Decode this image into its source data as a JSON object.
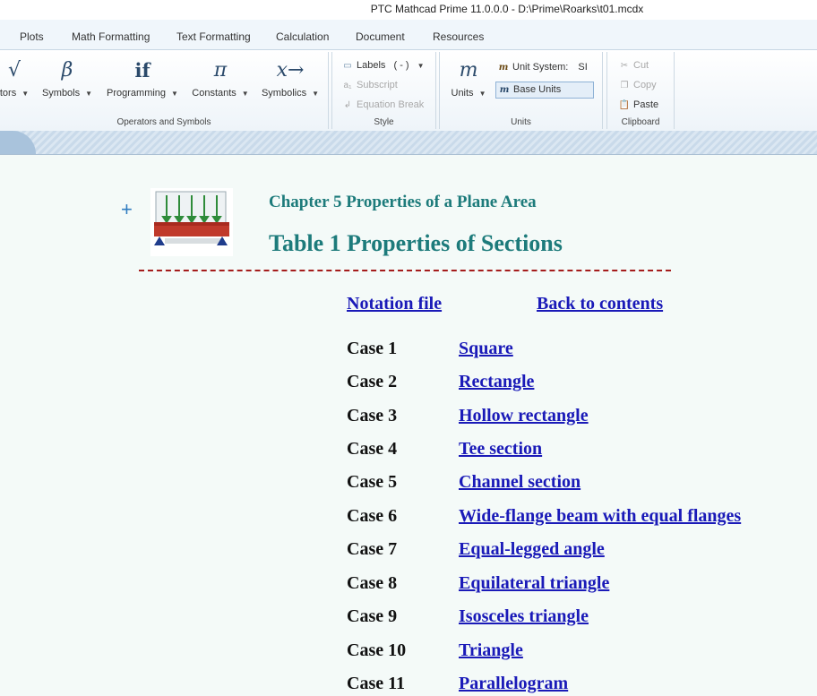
{
  "window": {
    "title": "PTC Mathcad Prime 11.0.0.0 - D:\\Prime\\Roarks\\t01.mcdx"
  },
  "tabs": [
    "Plots",
    "Math Formatting",
    "Text Formatting",
    "Calculation",
    "Document",
    "Resources"
  ],
  "ribbon": {
    "operators_group": {
      "label": "Operators and Symbols",
      "buttons": [
        {
          "label": "tors",
          "symbol": "√"
        },
        {
          "label": "Symbols",
          "symbol": "β"
        },
        {
          "label": "Programming",
          "symbol": "if"
        },
        {
          "label": "Constants",
          "symbol": "π"
        },
        {
          "label": "Symbolics",
          "symbol": "x→"
        }
      ]
    },
    "style_group": {
      "label": "Style",
      "labels_btn": "Labels",
      "labels_value": "( - )",
      "subscript": "Subscript",
      "equation_break": "Equation Break"
    },
    "units_group": {
      "label": "Units",
      "units_btn": "Units",
      "units_symbol": "m",
      "unit_system_label": "Unit System:",
      "unit_system_value": "SI",
      "base_units": "Base Units"
    },
    "clipboard_group": {
      "label": "Clipboard",
      "cut": "Cut",
      "copy": "Copy",
      "paste": "Paste"
    }
  },
  "document": {
    "plus": "+",
    "chapter": "Chapter 5  Properties of a Plane Area",
    "table_title": "Table 1  Properties of Sections",
    "notation_link": "Notation file",
    "contents_link": "Back to contents",
    "cases": [
      {
        "label": "Case 1",
        "name": "Square"
      },
      {
        "label": "Case 2",
        "name": "Rectangle"
      },
      {
        "label": "Case 3",
        "name": "Hollow rectangle"
      },
      {
        "label": "Case 4",
        "name": "Tee section"
      },
      {
        "label": "Case 5",
        "name": "Channel section"
      },
      {
        "label": "Case 6",
        "name": "Wide-flange beam with equal flanges"
      },
      {
        "label": "Case 7",
        "name": "Equal-legged angle"
      },
      {
        "label": "Case 8",
        "name": "Equilateral triangle"
      },
      {
        "label": "Case 9",
        "name": "Isosceles triangle"
      },
      {
        "label": "Case 10",
        "name": "Triangle"
      },
      {
        "label": "Case 11",
        "name": "Parallelogram"
      }
    ]
  }
}
